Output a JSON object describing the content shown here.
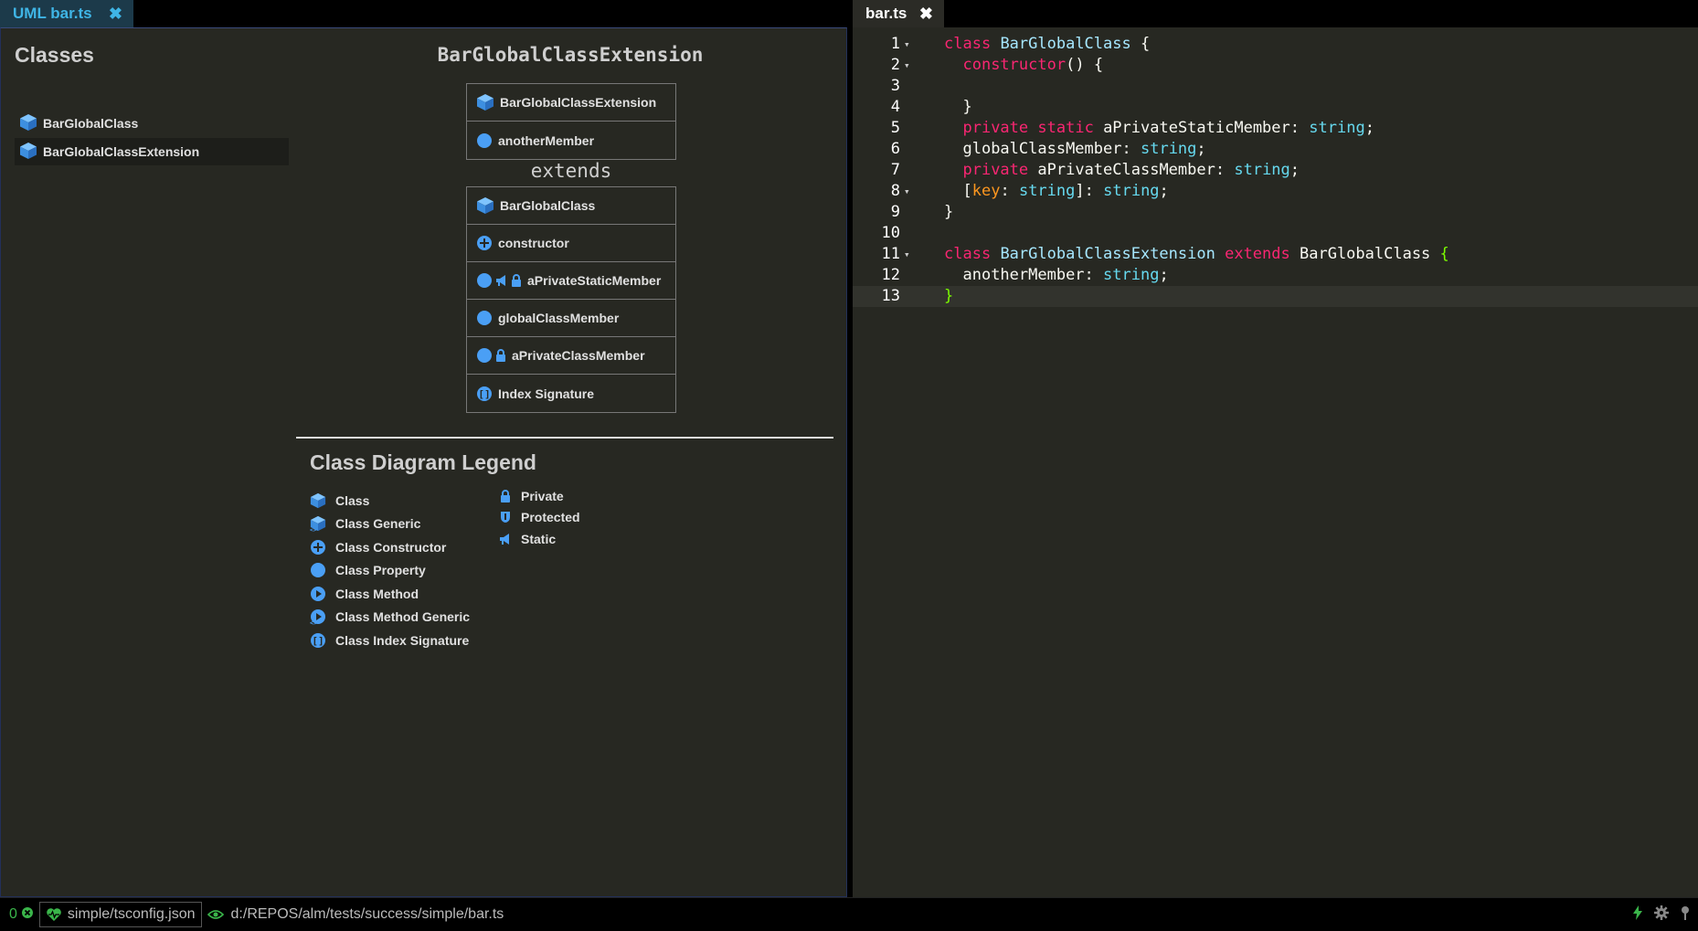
{
  "tabs": {
    "left": {
      "label": "UML bar.ts"
    },
    "right": {
      "label": "bar.ts"
    }
  },
  "classes_panel": {
    "title": "Classes",
    "items": [
      {
        "label": "BarGlobalClass",
        "selected": false
      },
      {
        "label": "BarGlobalClassExtension",
        "selected": true
      }
    ]
  },
  "diagram": {
    "title": "BarGlobalClassExtension",
    "extends_label": "extends",
    "child_box": {
      "header": "BarGlobalClassExtension",
      "members": [
        {
          "label": "anotherMember",
          "icon": "property-icon"
        }
      ]
    },
    "parent_box": {
      "header": "BarGlobalClass",
      "members": [
        {
          "label": "constructor",
          "icon": "constructor-icon"
        },
        {
          "label": "aPrivateStaticMember",
          "icon": "property-icon",
          "modifiers": [
            "static-icon",
            "lock-icon"
          ]
        },
        {
          "label": "globalClassMember",
          "icon": "property-icon"
        },
        {
          "label": "aPrivateClassMember",
          "icon": "property-icon",
          "modifiers": [
            "lock-icon"
          ]
        },
        {
          "label": "Index Signature",
          "icon": "index-signature-icon"
        }
      ]
    }
  },
  "legend": {
    "title": "Class Diagram Legend",
    "left_items": [
      {
        "label": "Class",
        "icon": "class-icon"
      },
      {
        "label": "Class Generic",
        "icon": "class-generic-icon"
      },
      {
        "label": "Class Constructor",
        "icon": "constructor-icon"
      },
      {
        "label": "Class Property",
        "icon": "property-icon"
      },
      {
        "label": "Class Method",
        "icon": "method-icon"
      },
      {
        "label": "Class Method Generic",
        "icon": "method-generic-icon"
      },
      {
        "label": "Class Index Signature",
        "icon": "index-signature-icon"
      }
    ],
    "right_items": [
      {
        "label": "Private",
        "icon": "lock-icon"
      },
      {
        "label": "Protected",
        "icon": "shield-icon"
      },
      {
        "label": "Static",
        "icon": "static-icon"
      }
    ]
  },
  "editor": {
    "lines": [
      {
        "num": "1",
        "fold": "▾",
        "code": "class BarGlobalClass {"
      },
      {
        "num": "2",
        "fold": "▾",
        "code": "  constructor() {"
      },
      {
        "num": "3",
        "fold": "",
        "code": ""
      },
      {
        "num": "4",
        "fold": "",
        "code": "  }"
      },
      {
        "num": "5",
        "fold": "",
        "code": "  private static aPrivateStaticMember: string;"
      },
      {
        "num": "6",
        "fold": "",
        "code": "  globalClassMember: string;"
      },
      {
        "num": "7",
        "fold": "",
        "code": "  private aPrivateClassMember: string;"
      },
      {
        "num": "8",
        "fold": "▾",
        "code": "  [key: string]: string;"
      },
      {
        "num": "9",
        "fold": "",
        "code": "}"
      },
      {
        "num": "10",
        "fold": "",
        "code": ""
      },
      {
        "num": "11",
        "fold": "▾",
        "code": "class BarGlobalClassExtension extends BarGlobalClass {"
      },
      {
        "num": "12",
        "fold": "",
        "code": "  anotherMember: string;"
      },
      {
        "num": "13",
        "fold": "",
        "code": "}"
      }
    ],
    "active_line": "13"
  },
  "statusbar": {
    "error_count": "0",
    "project": "simple/tsconfig.json",
    "file_path": "d:/REPOS/alm/tests/success/simple/bar.ts"
  },
  "colors": {
    "accent": "#3fb5e6",
    "icon_blue": "#4a9ff5",
    "keyword": "#f92672",
    "type": "#66d9ef",
    "status_green": "#3ab54a"
  }
}
